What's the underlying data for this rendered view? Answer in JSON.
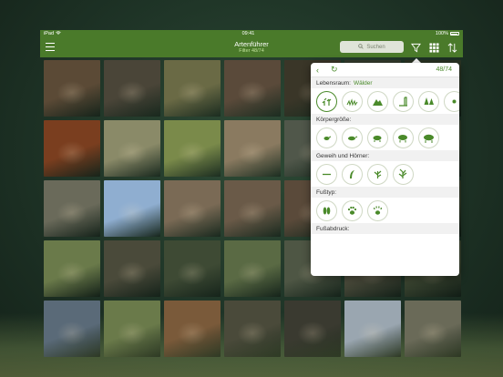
{
  "statusbar": {
    "carrier": "iPad",
    "time": "09:41",
    "battery": "100%"
  },
  "navbar": {
    "title": "Artenführer",
    "subtitle": "Filter 48/74",
    "search_placeholder": "Suchen",
    "icons": [
      "menu-icon",
      "search-icon",
      "filter-icon",
      "grid-icon",
      "sort-icon"
    ]
  },
  "grid": {
    "tiles": [
      {
        "id": "t1",
        "color": "#5b4a36"
      },
      {
        "id": "t2",
        "color": "#4a4538"
      },
      {
        "id": "t3",
        "color": "#6a6a45"
      },
      {
        "id": "t4",
        "color": "#5a4a3a"
      },
      {
        "id": "t5",
        "color": "#3a3628"
      },
      {
        "id": "t6",
        "color": "#333a2c"
      },
      {
        "id": "t7",
        "color": "#2a3323"
      },
      {
        "id": "t8",
        "color": "#7a3e1f"
      },
      {
        "id": "t9",
        "color": "#8a8a68"
      },
      {
        "id": "t10",
        "color": "#7a8a4a"
      },
      {
        "id": "t11",
        "color": "#8a7a60"
      },
      {
        "id": "t12",
        "color": "#50574a"
      },
      {
        "id": "t13",
        "color": "#3a4430"
      },
      {
        "id": "t14",
        "color": "#2f3a29"
      },
      {
        "id": "t15",
        "color": "#6a6a5a"
      },
      {
        "id": "t16",
        "color": "#8faed0"
      },
      {
        "id": "t17",
        "color": "#7a6a55"
      },
      {
        "id": "t18",
        "color": "#6a5a48"
      },
      {
        "id": "t19",
        "color": "#5a4a3a"
      },
      {
        "id": "t20",
        "color": "#3c4532"
      },
      {
        "id": "t21",
        "color": "#303a28"
      },
      {
        "id": "t22",
        "color": "#6a7a4a"
      },
      {
        "id": "t23",
        "color": "#4a4a3a"
      },
      {
        "id": "t24",
        "color": "#3e4a34"
      },
      {
        "id": "t25",
        "color": "#5a6a44"
      },
      {
        "id": "t26",
        "color": "#4e5644"
      },
      {
        "id": "t27",
        "color": "#4a4a3a"
      },
      {
        "id": "t28",
        "color": "#3a4430"
      },
      {
        "id": "t29",
        "color": "#5a6a78"
      },
      {
        "id": "t30",
        "color": "#6a7a4a"
      },
      {
        "id": "t31",
        "color": "#7a5a3a"
      },
      {
        "id": "t32",
        "color": "#4a4a3a"
      },
      {
        "id": "t33",
        "color": "#3a3a30"
      },
      {
        "id": "t34",
        "color": "#9aa6b0"
      },
      {
        "id": "t35",
        "color": "#6a6a58"
      }
    ]
  },
  "filter": {
    "count": "48/74",
    "sections": [
      {
        "label": "Lebensraum:",
        "value": "Wälder",
        "icons": [
          "forest-habitat-icon",
          "meadow-habitat-icon",
          "mountain-habitat-icon",
          "town-habitat-icon",
          "conifer-habitat-icon",
          "more-habitat-icon"
        ],
        "selected": 0
      },
      {
        "label": "Körpergröße:",
        "value": "",
        "icons": [
          "size-small-icon",
          "size-medium-icon",
          "size-large-icon",
          "size-xlarge-icon",
          "size-xxlarge-icon"
        ],
        "selected": -1
      },
      {
        "label": "Geweih und Hörner:",
        "value": "",
        "icons": [
          "no-antlers-icon",
          "horns-icon",
          "small-antlers-icon",
          "large-antlers-icon"
        ],
        "selected": -1
      },
      {
        "label": "Fußtyp:",
        "value": "",
        "icons": [
          "hoof-icon",
          "paw-icon",
          "claw-paw-icon"
        ],
        "selected": -1
      },
      {
        "label": "Fußabdruck:",
        "value": "",
        "icons": [],
        "selected": -1
      }
    ]
  },
  "colors": {
    "accent": "#4a7a2a",
    "accent_text": "#4a8a2a"
  }
}
